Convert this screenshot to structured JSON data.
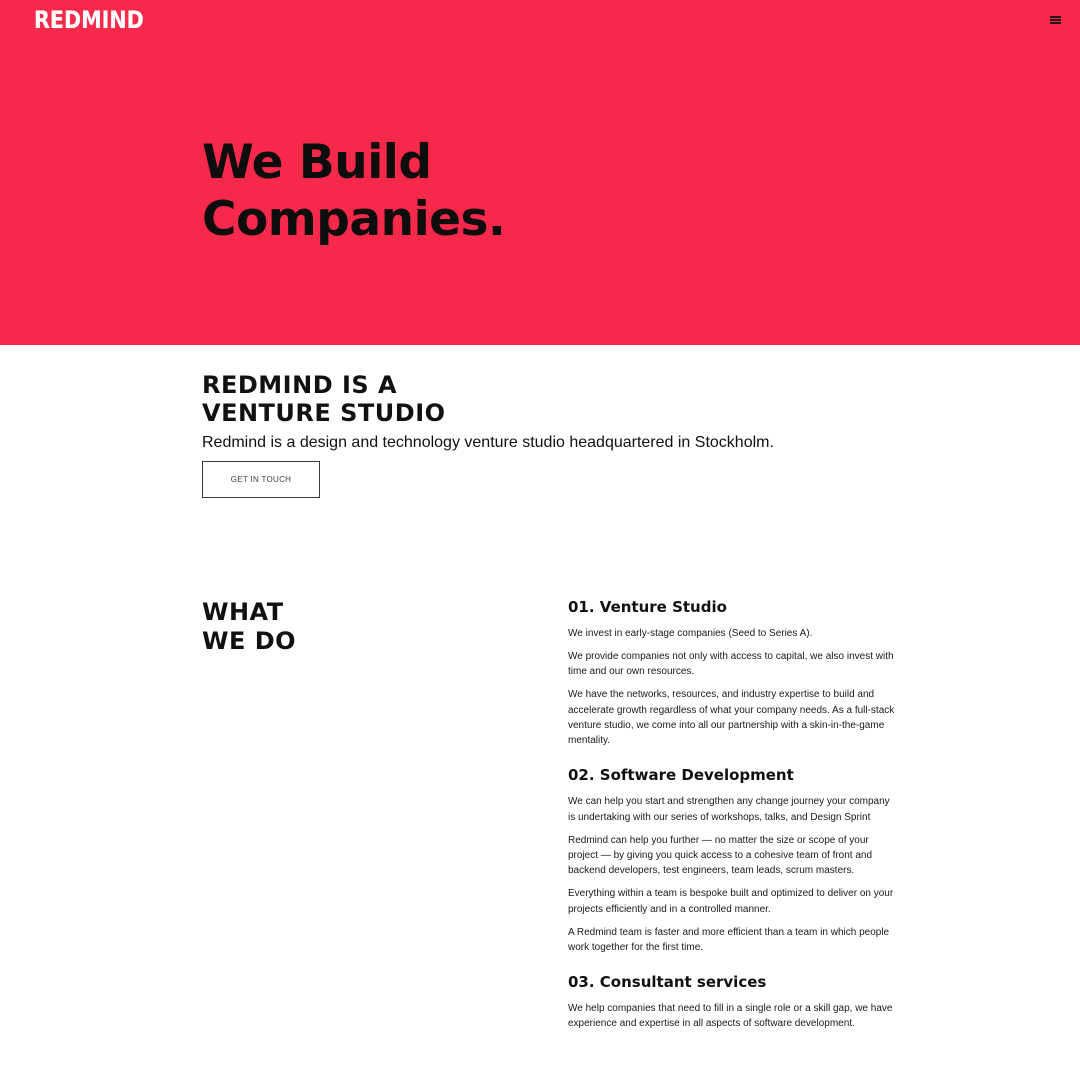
{
  "header": {
    "logo_text": "REDMIND",
    "menu_icon": "hamburger-menu-icon"
  },
  "hero": {
    "title_line1": "We Build",
    "title_line2": "Companies."
  },
  "intro": {
    "title_line1": "REDMIND IS A",
    "title_line2": "VENTURE STUDIO",
    "text": "Redmind is a design and technology venture studio headquartered in Stockholm.",
    "cta_label": "GET IN TOUCH"
  },
  "what_we_do": {
    "title_line1": "WHAT",
    "title_line2": "WE DO",
    "services": [
      {
        "title": "01. Venture Studio",
        "paragraphs": [
          "We invest in early-stage companies (Seed to Series A).",
          "We provide companies not only with access to capital, we also invest with time and our own resources.",
          "We have the networks, resources, and industry expertise to build and accelerate growth regardless of what your company needs. As a full-stack venture studio, we come into all our partnership with a skin-in-the-game mentality."
        ]
      },
      {
        "title": "02. Software Development",
        "paragraphs": [
          "We can help you start and strengthen any change journey your company is undertaking with our series of workshops, talks, and Design Sprint",
          "Redmind can help you further — no matter the size or scope of your project — by giving you quick access to a cohesive team of front and backend developers, test engineers, team leads, scrum masters.",
          "Everything within a team is bespoke built and optimized to deliver on your projects efficiently and in a controlled manner.",
          "A Redmind team is faster and more efficient than a team in which people work together for the first time."
        ]
      },
      {
        "title": "03. Consultant services",
        "paragraphs": [
          "We help companies that need to fill in a single role or a skill gap, we have experience and expertise in all aspects of software development."
        ]
      }
    ]
  },
  "colors": {
    "brand_red": "#f7294a",
    "text_dark": "#111111",
    "background": "#ffffff"
  }
}
